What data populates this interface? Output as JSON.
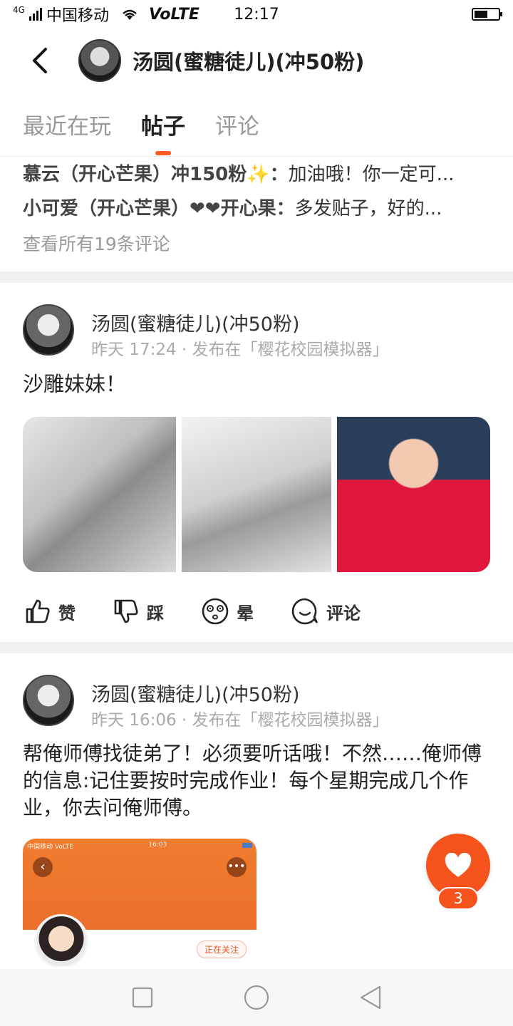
{
  "status_bar": {
    "carrier": "中国移动",
    "network": "4G",
    "volte": "VoLTE",
    "time": "12:17",
    "battery_level": 0.55
  },
  "header": {
    "back_icon": "chevron-left-icon",
    "title": "汤圆(蜜糖徒儿)(冲50粉)"
  },
  "tabs": [
    {
      "label": "最近在玩",
      "active": false
    },
    {
      "label": "帖子",
      "active": true
    },
    {
      "label": "评论",
      "active": false
    }
  ],
  "comments_preview": {
    "items": [
      {
        "user": "慕云（开心芒果）冲150粉✨：",
        "text": "加油哦！你一定可..."
      },
      {
        "user": "小可爱（开心芒果）❤❤开心果：",
        "text": "多发贴子，好的..."
      }
    ],
    "view_all": "查看所有19条评论"
  },
  "posts": [
    {
      "author": "汤圆(蜜糖徒儿)(冲50粉)",
      "meta": "昨天 17:24 · 发布在「樱花校园模拟器」",
      "text": "沙雕妹妹！",
      "actions": {
        "like": "赞",
        "dislike": "踩",
        "dizzy": "晕",
        "comment": "评论"
      }
    },
    {
      "author": "汤圆(蜜糖徒儿)(冲50粉)",
      "meta": "昨天 16:06 · 发布在「樱花校园模拟器」",
      "text": "帮俺师傅找徒弟了！必须要听话哦！不然……俺师傅的信息:记住要按时完成作业！每个星期完成几个作业，你去问俺师傅。",
      "embedded_screenshot": {
        "status_left": "中国移动 VoLTE",
        "status_time": "16:03",
        "follow_label": "正在关注"
      }
    }
  ],
  "floating_like": {
    "icon": "heart-icon",
    "count": "3",
    "color": "#f5521c"
  },
  "nav_bar": {
    "recent_icon": "square-icon",
    "home_icon": "circle-icon",
    "back_icon": "triangle-back-icon"
  },
  "colors": {
    "accent": "#ff5a1f",
    "muted": "#999999"
  }
}
